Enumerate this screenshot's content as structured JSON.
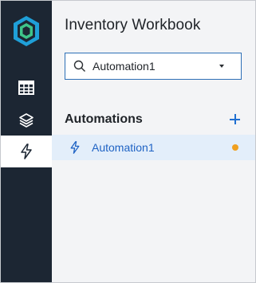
{
  "app": {
    "title": "Inventory Workbook"
  },
  "rail": {
    "logo_icon": "hexagon-logo-icon",
    "items": [
      {
        "icon": "table-icon",
        "active": false
      },
      {
        "icon": "layers-icon",
        "active": false
      },
      {
        "icon": "lightning-icon",
        "active": true
      }
    ]
  },
  "search": {
    "value": "Automation1",
    "icon": "search-icon"
  },
  "section": {
    "label": "Automations",
    "add_icon": "plus-icon"
  },
  "automations": [
    {
      "label": "Automation1",
      "icon": "lightning-icon",
      "status_color": "#f0a020",
      "selected": true
    }
  ],
  "colors": {
    "rail_bg": "#1c2633",
    "accent": "#1f6fd1",
    "selected_bg": "#e3eefa",
    "status_pending": "#f0a020"
  }
}
